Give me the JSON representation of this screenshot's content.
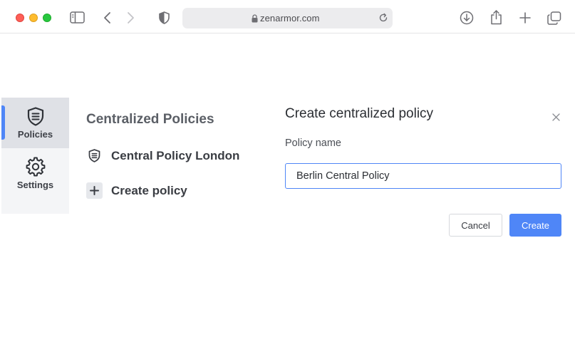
{
  "browser": {
    "url": "zenarmor.com",
    "icons": [
      "close-window",
      "minimize-window",
      "zoom-window",
      "sidebar-toggle",
      "back-arrow",
      "forward-arrow",
      "privacy-shield",
      "lock",
      "reload",
      "download",
      "share",
      "new-tab",
      "tab-overview"
    ]
  },
  "sidebar": {
    "items": [
      {
        "label": "Policies",
        "icon": "shield-list-icon",
        "active": true
      },
      {
        "label": "Settings",
        "icon": "gear-icon",
        "active": false
      }
    ]
  },
  "policies": {
    "title": "Centralized Policies",
    "items": [
      {
        "label": "Central Policy London",
        "icon": "shield-list-icon"
      }
    ],
    "create_label": "Create policy"
  },
  "form": {
    "title": "Create centralized policy",
    "name_label": "Policy name",
    "name_value": "Berlin Central Policy",
    "cancel_label": "Cancel",
    "create_label": "Create"
  },
  "colors": {
    "accent": "#4f86f7",
    "sidebar_bg": "#f4f5f7",
    "sidebar_active_bg": "#dfe1e6"
  }
}
